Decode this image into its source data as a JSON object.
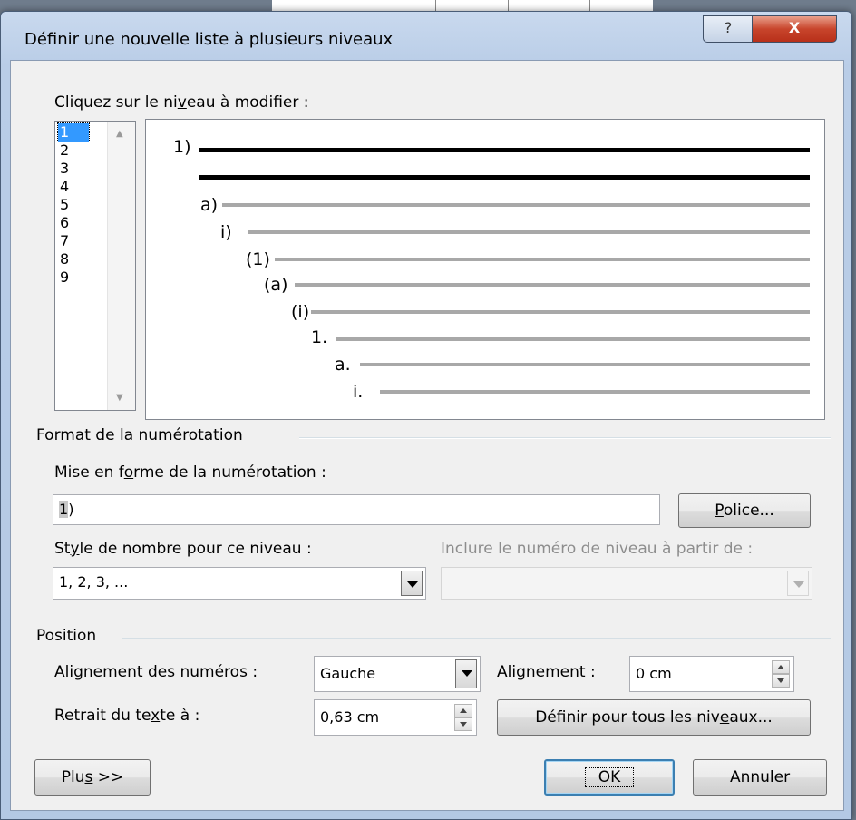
{
  "dialog": {
    "title": "Définir une nouvelle liste à plusieurs niveaux",
    "help_icon": "?",
    "close_icon": "X"
  },
  "levels": {
    "label_pre": "Cliquez sur le ni",
    "label_u": "v",
    "label_post": "eau à modifier :",
    "items": [
      "1",
      "2",
      "3",
      "4",
      "5",
      "6",
      "7",
      "8",
      "9"
    ],
    "selected": "1"
  },
  "preview": {
    "numbers": [
      "1)",
      "a)",
      "i)",
      "(1)",
      "(a)",
      "(i)",
      "1.",
      "a.",
      "i."
    ]
  },
  "numbering_format": {
    "group_label": "Format de la numérotation",
    "format_label_pre": "Mise en f",
    "format_label_u": "o",
    "format_label_post": "rme de la numérotation :",
    "format_value_sel": "1",
    "format_value_rest": ")",
    "font_button_u": "P",
    "font_button_rest": "olice...",
    "style_label_pre": "St",
    "style_label_u": "y",
    "style_label_post": "le de nombre pour ce niveau :",
    "style_value": "1, 2, 3, ...",
    "include_label": "Inclure le numéro de niveau à partir de :",
    "include_value": ""
  },
  "position": {
    "group_label": "Position",
    "align_label_pre": "Alignement des n",
    "align_label_u": "u",
    "align_label_post": "méros :",
    "align_value": "Gauche",
    "alignment_label_u": "A",
    "alignment_label_rest": "lignement :",
    "alignment_value": "0 cm",
    "indent_label_pre": "Retrait du te",
    "indent_label_u": "x",
    "indent_label_post": "te à :",
    "indent_value": "0,63 cm",
    "set_all_pre": "Définir pour tous les niv",
    "set_all_u": "e",
    "set_all_post": "aux..."
  },
  "footer": {
    "more_pre": "Plu",
    "more_u": "s",
    "more_post": " >>",
    "ok": "OK",
    "cancel": "Annuler"
  }
}
